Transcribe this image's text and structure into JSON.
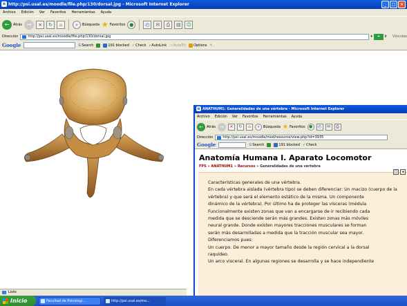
{
  "main_window": {
    "title": "http://psi.usal.es/moodle/file.php/130/dorsal.jpg - Microsoft Internet Explorer",
    "menu": [
      "Archivo",
      "Edición",
      "Ver",
      "Favoritos",
      "Herramientas",
      "Ayuda"
    ],
    "toolbar": {
      "back_label": "Atrás",
      "search_label": "Búsqueda",
      "favorites_label": "Favoritos"
    },
    "address": {
      "label": "Dirección",
      "url": "http://psi.usal.es/moodle/file.php/130/dorsal.jpg",
      "go_label": "Ir",
      "links_label": "Vínculos"
    },
    "google": {
      "logo": "Google",
      "search_label": "Search",
      "blocked_label": "191 blocked",
      "check_label": "Check",
      "autolink_label": "AutoLink",
      "autofill_label": "AutoFill",
      "options_label": "Options"
    },
    "status": "Listo"
  },
  "taskbar": {
    "start_label": "Inicio",
    "items": [
      {
        "label": "Facultad de Psicologí..."
      },
      {
        "label": "http://psi.usal.es/mo..."
      }
    ]
  },
  "second_window": {
    "title": "ANATHUM1: Generalidades de una vértebra - Microsoft Internet Explorer",
    "menu": [
      "Archivo",
      "Edición",
      "Ver",
      "Favoritos",
      "Herramientas",
      "Ayuda"
    ],
    "toolbar": {
      "back_label": "Atrás",
      "search_label": "Búsqueda",
      "favorites_label": "Favoritos"
    },
    "address": {
      "label": "Dirección",
      "url": "http://psi.usal.es/moodle/mod/resource/view.php?id=3935"
    },
    "google": {
      "logo": "Google",
      "search_label": "Search",
      "blocked_label": "191 blocked",
      "check_label": "Check"
    },
    "course_title": "Anatomía Humana I. Aparato Locomotor",
    "breadcrumb": {
      "items": [
        "FPS",
        "ANATHUM1",
        "Recursos"
      ],
      "current": "Generalidades de una vértebra"
    },
    "paragraphs": [
      "Características generales de una vértebra.",
      "En cada vértebra aislada (vértebra tipo) se deben diferenciar: Un macizo (cuerpo de la",
      "vértebra) y que será el elemento estático de la misma. Un componente",
      "dinámico de la vértebra). Por último ha de proteger las vísceras (médula",
      "Funcionalmente existen zonas que van a encargarse de ir recibiendo cada",
      "medida que se desciende serán más grandes. Existen zonas más móviles",
      "neural grande. Donde existen mayores tracciones musculares se forman",
      "serán más desarrolladas a medida que la tracción muscular sea mayor.",
      "Diferenciamos pues:",
      "Un cuerpo. De menor a mayor tamaño desde la región cervical a la dorsal",
      "raquídeo.",
      "Un arco visceral. En algunas regiones se desarrolla y se hace independiente"
    ]
  }
}
